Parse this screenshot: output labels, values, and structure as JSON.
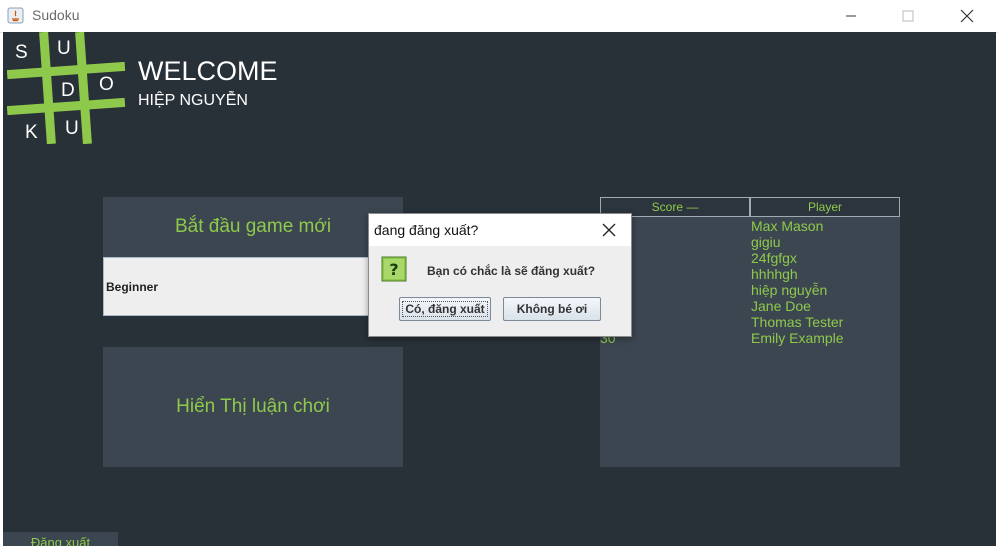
{
  "window": {
    "title": "Sudoku"
  },
  "logo": {
    "letters": [
      "S",
      "U",
      "D",
      "O",
      "K",
      "U"
    ],
    "color": "#8fc94b"
  },
  "header": {
    "welcome": "WELCOME",
    "user": "HIỆP NGUYỄN"
  },
  "new_game": {
    "label": "Bắt đầu game mới",
    "level": "Beginner"
  },
  "history": {
    "label": "Hiển Thị luận chơi"
  },
  "leaderboard": {
    "columns": {
      "score": "Score —",
      "player": "Player"
    },
    "scores": [
      "",
      "",
      "",
      "",
      "",
      "",
      "",
      "30"
    ],
    "players": [
      "Max Mason",
      "gigiu",
      "24fgfgx",
      "hhhhgh",
      "hiệp nguyễn",
      "Jane Doe",
      "Thomas Tester",
      "Emily Example"
    ]
  },
  "logout": {
    "label": "Đăng xuất"
  },
  "dialog": {
    "title": "đang đăng xuất?",
    "message": "Bạn có chắc là sẽ đăng xuất?",
    "yes": "Có, đăng xuất",
    "no": "Không bé ơi",
    "icon": "question-icon"
  },
  "colors": {
    "background": "#283038",
    "panel": "#3b4650",
    "accent": "#8fc94b"
  }
}
